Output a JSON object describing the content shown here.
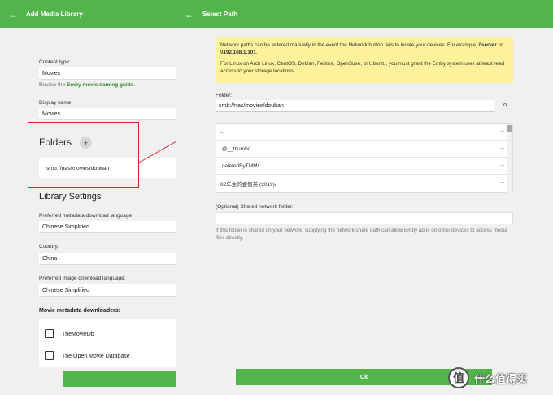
{
  "left": {
    "title": "Add Media Library",
    "back_glyph": "←",
    "content_type_label": "Content type:",
    "content_type_value": "Movies",
    "naming_prefix": "Review the ",
    "naming_link": "Emby movie naming guide",
    "naming_suffix": ".",
    "display_name_label": "Display name:",
    "display_name_value": "Movies",
    "folders_heading": "Folders",
    "add_glyph": "+",
    "folder_path": "smb://nas/movies/douban",
    "library_settings_heading": "Library Settings",
    "meta_lang_label": "Preferred metadata download language:",
    "meta_lang_value": "Chinese Simplified",
    "country_label": "Country:",
    "country_value": "China",
    "image_lang_label": "Preferred image download language:",
    "image_lang_value": "Chinese Simplified",
    "downloaders_heading": "Movie metadata downloaders:",
    "downloaders": [
      {
        "label": "TheMovieDb"
      },
      {
        "label": "The Open Movie Database"
      }
    ]
  },
  "right": {
    "title": "Select Path",
    "back_glyph": "←",
    "notice_line1_a": "Network paths can be entered manually in the event the Network button fails to locate your devices. For example, ",
    "notice_server": "\\\\server",
    "notice_or": " or ",
    "notice_ip": "\\\\192.168.1.101",
    "notice_end": ".",
    "notice_line2": "For Linux on Arch Linux, CentOS, Debian, Fedora, OpenSuse, or Ubuntu, you must grant the Emby system user at least read access to your storage locations.",
    "folder_label": "Folder:",
    "folder_value": "smb://nas/movies/douban",
    "search_glyph": "⌕",
    "rows": [
      {
        "name": "...",
        "arrow": "→"
      },
      {
        "name": ".@__thumb/",
        "arrow": "→"
      },
      {
        "name": ".deletedByTMM/",
        "arrow": "→"
      },
      {
        "name": "82年生的金智英 (2019)/",
        "arrow": "→"
      }
    ],
    "shared_label": "(Optional) Shared network folder:",
    "shared_value": "",
    "shared_hint": "If this folder is shared on your network, supplying the network share path can allow Emby apps on other devices to access media files directly.",
    "ok_label": "Ok"
  },
  "watermark": {
    "glyph": "值",
    "text": "什么值得买"
  },
  "colors": {
    "accent": "#52b54b",
    "notice_bg": "#fcf29b",
    "link": "#2f8a29",
    "callout": "#e02020"
  }
}
